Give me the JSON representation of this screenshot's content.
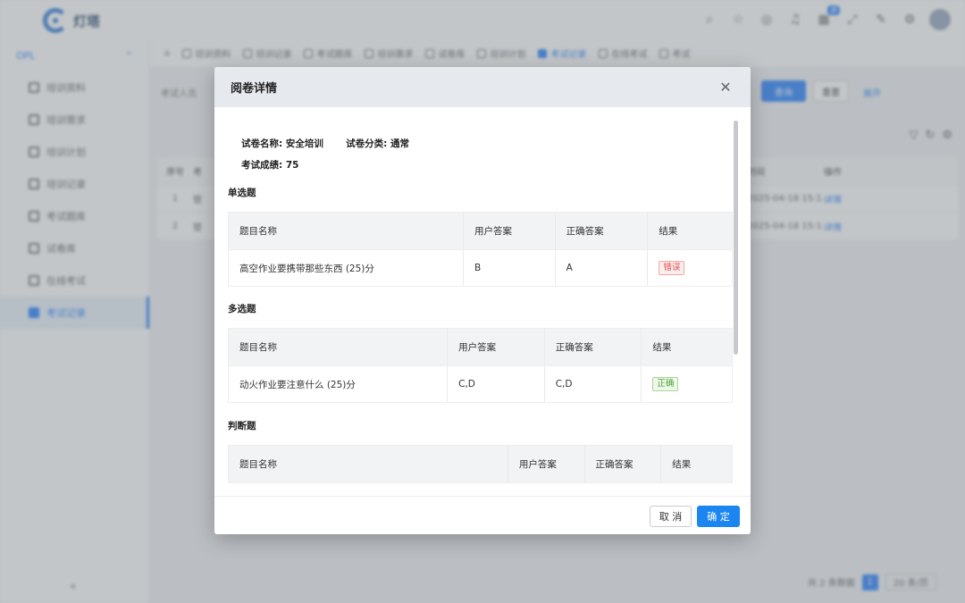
{
  "app": {
    "brand": "灯塔",
    "new_badge": "新",
    "sidebar": {
      "group": "OPL",
      "items": [
        "培训资料",
        "培训需求",
        "培训计划",
        "培训记录",
        "考试题库",
        "试卷库",
        "在线考试",
        "考试记录"
      ],
      "active_index": 7,
      "collapse": "«"
    },
    "tabs": [
      {
        "label": "培训资料"
      },
      {
        "label": "培训记录"
      },
      {
        "label": "考试题库"
      },
      {
        "label": "培训需求"
      },
      {
        "label": "试卷库"
      },
      {
        "label": "培训计划"
      },
      {
        "label": "考试记录",
        "active": true
      },
      {
        "label": "在线考试"
      },
      {
        "label": "考试"
      }
    ],
    "filter": {
      "label": "考试人员",
      "query": "查询",
      "reset": "重置",
      "expand": "展开"
    },
    "table": {
      "headers": [
        "序号",
        "考",
        "时间",
        "操作"
      ],
      "rows": [
        {
          "no": "1",
          "col2": "管",
          "time": "2025-04-18 15:1...",
          "op": "详情"
        },
        {
          "no": "2",
          "col2": "管",
          "time": "2025-04-18 15:1...",
          "op": "详情"
        }
      ]
    },
    "pager": {
      "total": "共 2 条数据",
      "page": "1",
      "size": "20 条/页"
    }
  },
  "modal": {
    "title": "阅卷详情",
    "close_icon": "close-icon",
    "info": {
      "paper_name_label": "试卷名称:",
      "paper_name": "安全培训",
      "category_label": "试卷分类:",
      "category": "通常",
      "score_label": "考试成绩:",
      "score": "75"
    },
    "sections": [
      {
        "title": "单选题",
        "headers": [
          "题目名称",
          "用户答案",
          "正确答案",
          "结果"
        ],
        "rows": [
          {
            "question": "高空作业要携带那些东西 (25)分",
            "user_answer": "B",
            "correct_answer": "A",
            "result": "错误"
          }
        ]
      },
      {
        "title": "多选题",
        "headers": [
          "题目名称",
          "用户答案",
          "正确答案",
          "结果"
        ],
        "rows": [
          {
            "question": "动火作业要注意什么 (25)分",
            "user_answer": "C,D",
            "correct_answer": "C,D",
            "result": "正确"
          }
        ]
      },
      {
        "title": "判断题",
        "headers": [
          "题目名称",
          "用户答案",
          "正确答案",
          "结果"
        ],
        "rows": []
      }
    ],
    "footer": {
      "cancel": "取 消",
      "ok": "确 定"
    },
    "colors": {
      "primary": "#1c86f0",
      "wrong": "#e24b4b",
      "right": "#4aa336"
    }
  }
}
